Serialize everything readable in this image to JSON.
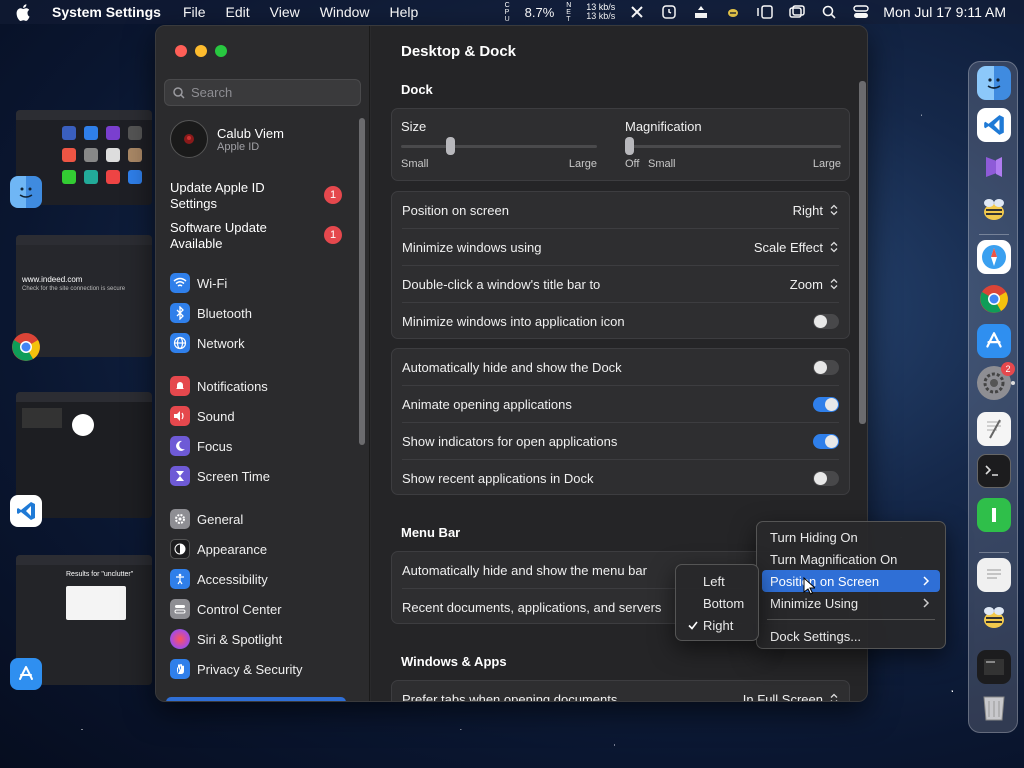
{
  "menubar": {
    "app_name": "System Settings",
    "menus": [
      "File",
      "Edit",
      "View",
      "Window",
      "Help"
    ],
    "cpu_label": "CPU",
    "cpu_value": "8.7%",
    "net_label": "NET",
    "net_up": "13 kb/s",
    "net_down": "13 kb/s",
    "clock": "Mon Jul 17  9:11 AM"
  },
  "thumbnails": {
    "browser_url": "www.indeed.com",
    "browser_line": "Check for the site connection is secure",
    "finder_title": "Results for \"unclutter\""
  },
  "sidebar": {
    "search_placeholder": "Search",
    "profile_name": "Calub Viem",
    "profile_sub": "Apple ID",
    "updates": [
      {
        "label": "Update Apple ID Settings",
        "badge": "1"
      },
      {
        "label": "Software Update Available",
        "badge": "1"
      }
    ],
    "items": [
      {
        "label": "Wi-Fi",
        "color": "#2f7fea"
      },
      {
        "label": "Bluetooth",
        "color": "#2f7fea"
      },
      {
        "label": "Network",
        "color": "#2f7fea"
      },
      {
        "label": "Notifications",
        "color": "#e5484d"
      },
      {
        "label": "Sound",
        "color": "#e5484d"
      },
      {
        "label": "Focus",
        "color": "#6e5ad6"
      },
      {
        "label": "Screen Time",
        "color": "#6e5ad6"
      },
      {
        "label": "General",
        "color": "#8e8e93"
      },
      {
        "label": "Appearance",
        "color": "#1c1c1e"
      },
      {
        "label": "Accessibility",
        "color": "#2f7fea"
      },
      {
        "label": "Control Center",
        "color": "#8e8e93"
      },
      {
        "label": "Siri & Spotlight",
        "color": "#b04ad8"
      },
      {
        "label": "Privacy & Security",
        "color": "#2f7fea"
      }
    ]
  },
  "content": {
    "title": "Desktop & Dock",
    "dock_section": "Dock",
    "size_label": "Size",
    "size_small": "Small",
    "size_large": "Large",
    "size_level": 0.24,
    "mag_label": "Magnification",
    "mag_off": "Off",
    "mag_small": "Small",
    "mag_large": "Large",
    "mag_level": 0.0,
    "position_label": "Position on screen",
    "position_value": "Right",
    "minimize_label": "Minimize windows using",
    "minimize_value": "Scale Effect",
    "doubleclick_label": "Double-click a window's title bar to",
    "doubleclick_value": "Zoom",
    "minimize_icon_label": "Minimize windows into application icon",
    "autohide_label": "Automatically hide and show the Dock",
    "animate_label": "Animate opening applications",
    "indicators_label": "Show indicators for open applications",
    "recent_label": "Show recent applications in Dock",
    "menubar_section": "Menu Bar",
    "menubar_autohide_label": "Automatically hide and show the menu bar",
    "recent_docs_label": "Recent documents, applications, and servers",
    "windows_section": "Windows & Apps",
    "prefer_tabs_label": "Prefer tabs when opening documents",
    "prefer_tabs_value": "In Full Screen",
    "toggles": {
      "minimize_icon": false,
      "autohide": false,
      "animate": true,
      "indicators": true,
      "recent": false
    }
  },
  "dock_menu": {
    "items": [
      "Turn Hiding On",
      "Turn Magnification On",
      "Position on Screen",
      "Minimize Using",
      "Dock Settings..."
    ],
    "highlighted": "Position on Screen"
  },
  "position_submenu": {
    "items": [
      "Left",
      "Bottom",
      "Right"
    ],
    "checked": "Right"
  },
  "dock": {
    "trash_badge": "2",
    "accent": "#2f7fea"
  }
}
